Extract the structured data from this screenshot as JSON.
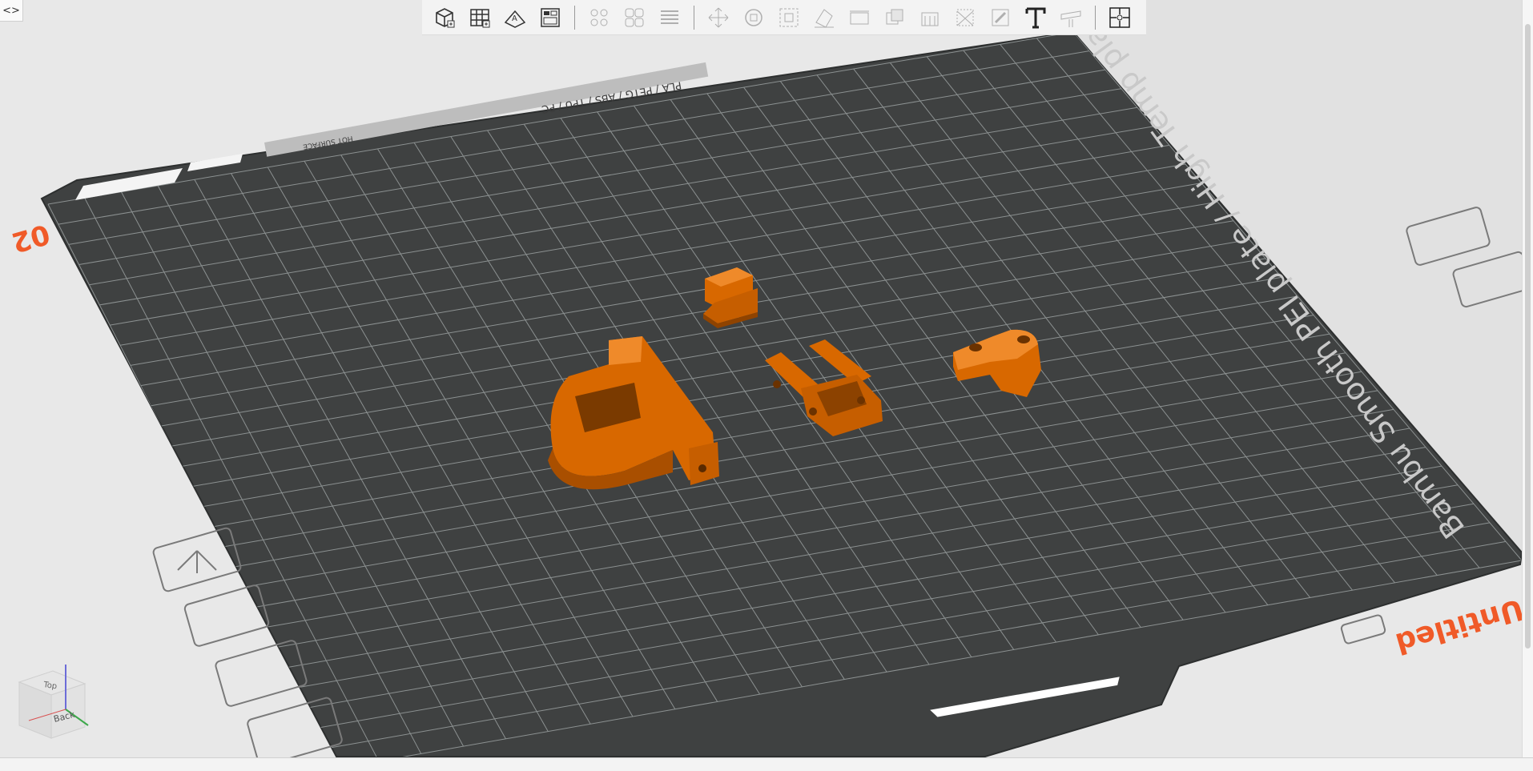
{
  "toolbar": {
    "items": [
      {
        "name": "add-object-icon",
        "enabled": true
      },
      {
        "name": "add-plate-icon",
        "enabled": true
      },
      {
        "name": "auto-orient-icon",
        "enabled": true
      },
      {
        "name": "arrange-icon",
        "enabled": true
      },
      {
        "name": "split-objects-icon",
        "enabled": false
      },
      {
        "name": "split-parts-icon",
        "enabled": false
      },
      {
        "name": "layers-icon",
        "enabled": false
      },
      {
        "name": "move-icon",
        "enabled": false
      },
      {
        "name": "rotate-icon",
        "enabled": false
      },
      {
        "name": "scale-icon",
        "enabled": false
      },
      {
        "name": "lay-on-face-icon",
        "enabled": false
      },
      {
        "name": "cut-icon",
        "enabled": false
      },
      {
        "name": "boolean-icon",
        "enabled": false
      },
      {
        "name": "support-paint-icon",
        "enabled": false
      },
      {
        "name": "seam-paint-icon",
        "enabled": false
      },
      {
        "name": "color-paint-icon",
        "enabled": false
      },
      {
        "name": "text-icon",
        "enabled": true
      },
      {
        "name": "measure-icon",
        "enabled": false
      },
      {
        "name": "assembly-icon",
        "enabled": true
      }
    ]
  },
  "collapse_glyph": "<>",
  "bed": {
    "plate_label": "Bambu Smooth PEI plate / High Temp plate",
    "materials": "PLA / PETG / ABS / TPU / PC",
    "surface_label": "HOT SURFACE",
    "plate_number": "02",
    "plate_name": "Untitled"
  },
  "view_cube": {
    "top": "Top",
    "back": "Back"
  },
  "colors": {
    "bed": "#3f4141",
    "grid": "#8c9191",
    "part": "#d86800",
    "part_dark": "#a94f00",
    "accent": "#f05a28"
  }
}
